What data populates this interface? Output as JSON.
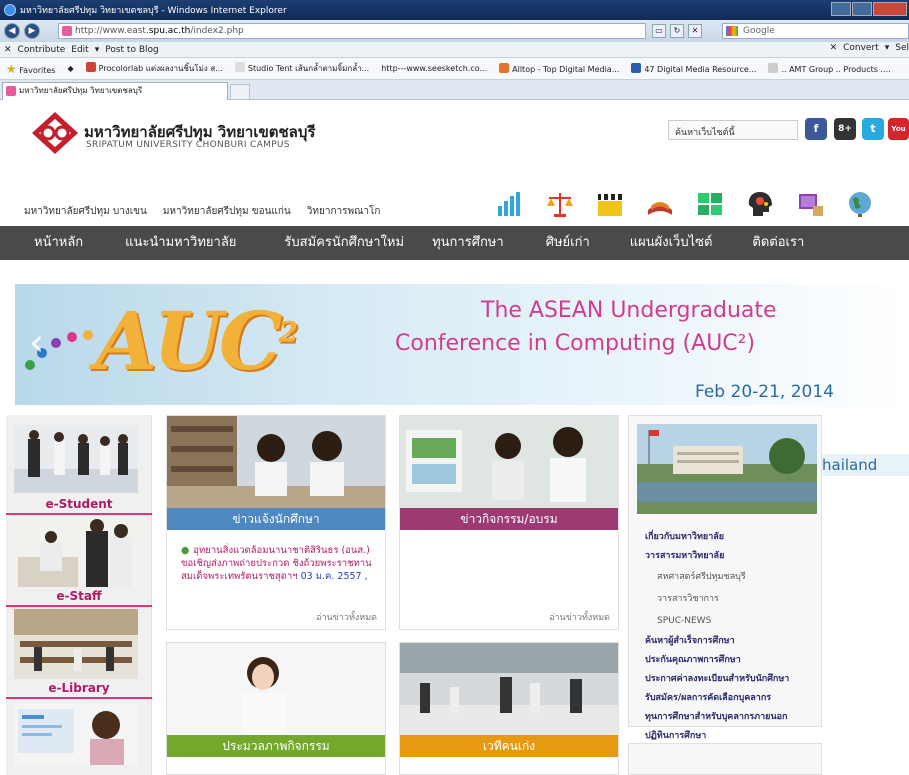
{
  "browser": {
    "window_title": "มหาวิทยาลัยศรีปทุม วิทยาเขตชลบุรี - Windows Internet Explorer",
    "url_prefix": "http://www.east.",
    "url_domain": "spu.ac.th",
    "url_path": "/index2.php",
    "search_placeholder": "Google",
    "toolbar_left": [
      "Contribute",
      "Edit",
      "Post to Blog"
    ],
    "toolbar_right": [
      "Convert",
      "Sel"
    ],
    "favorites_label": "Favorites",
    "favorites": [
      "Procolorlab แต่งผลงานชิ้นโม่ง ส...",
      "Studio Tent เส้นกล้ำตามจิ้มกล้ำ...",
      "http---www.seesketch.co...",
      "Alltop - Top Digital Media...",
      "47 Digital Media Resource...",
      ".. AMT Group .. Products ...."
    ],
    "tab_title": "มหาวิทยาลัยศรีปทุม วิทยาเขตชลบุรี"
  },
  "header": {
    "name_th": "มหาวิทยาลัยศรีปทุม วิทยาเขตชลบุรี",
    "name_en": "SRIPATUM UNIVERSITY CHONBURI CAMPUS",
    "search_text": "ค้นหาเว็บไซต์นี้",
    "social": [
      "f",
      "8+",
      "t",
      "You"
    ],
    "campus_links": [
      "มหาวิทยาลัยศรีปทุม บางเขน",
      "มหาวิทยาลัยศรีปทุม ขอนแก่น",
      "วิทยาการพณาโก"
    ]
  },
  "nav": [
    "หน้าหลัก",
    "แนะนำมหาวิทยาลัย",
    "รับสมัครนักศึกษาใหม่",
    "ทุนการศึกษา",
    "ศิษย์เก่า",
    "แผนผังเว็บไซต์",
    "ติดต่อเรา"
  ],
  "banner": {
    "logo_text": "AUC",
    "logo_sup": "2",
    "line1": "The ASEAN Undergraduate",
    "line2": "Conference in Computing (AUC²)",
    "line3": "Feb 20-21, 2014",
    "line4": "hailand"
  },
  "leftcol": [
    "e-Student",
    "e-Staff",
    "e-Library"
  ],
  "cards": [
    {
      "title": "ข่าวแจ้งนักศึกษา",
      "more": "อ่านข่าวทั้งหมด",
      "bar_color": "#4f87c1"
    },
    {
      "title": "ข่าวกิจกรรม/อบรม",
      "more": "อ่านข่าวทั้งหมด",
      "bar_color": "#9d3a73"
    },
    {
      "title": "ประมวลภาพกิจกรรม",
      "bar_color": "#73a82c"
    },
    {
      "title": "เวทีคนเก่ง",
      "bar_color": "#e69a12"
    }
  ],
  "news": {
    "text": "อุทยานสิ่งแวดล้อมนานาชาติสิรินธร (อนส.) ขอเชิญส่งภาพถ่ายประกวด ชิงถ้วยพระราชทานสมเด็จพระเทพรัตนราชสุดาฯ",
    "date": "03 ม.ค. 2557 ,"
  },
  "rightmenu": [
    {
      "text": "เกี่ยวกับมหาวิทยาลัย",
      "sub": false
    },
    {
      "text": "วารสารมหาวิทยาลัย",
      "sub": false
    },
    {
      "text": "สหศาสตร์ศรีปทุมชลบุรี",
      "sub": true
    },
    {
      "text": "วารสารวิชาการ",
      "sub": true
    },
    {
      "text": "SPUC-NEWS",
      "sub": true
    },
    {
      "text": "ค้นหาผู้สำเร็จการศึกษา",
      "sub": false
    },
    {
      "text": "ประกันคุณภาพการศึกษา",
      "sub": false
    },
    {
      "text": "ประกาศค่าลงทะเบียนสำหรับนักศึกษา",
      "sub": false
    },
    {
      "text": "รับสมัคร/ผลการคัดเลือกบุคลากร",
      "sub": false
    },
    {
      "text": "ทุนการศึกษาสำหรับบุคลากรภายนอก",
      "sub": false
    },
    {
      "text": "ปฏิทินการศึกษา",
      "sub": false
    }
  ]
}
